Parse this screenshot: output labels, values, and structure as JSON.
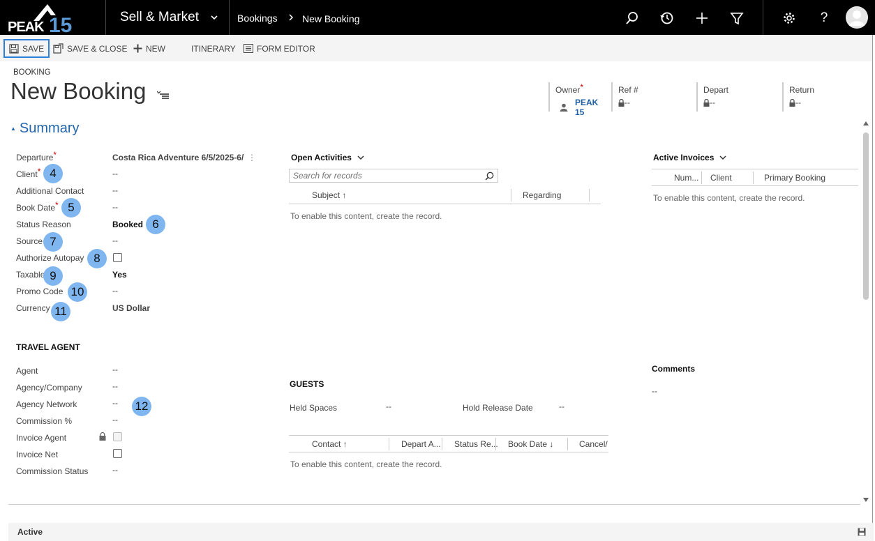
{
  "brand": {
    "logo_text": "PEAK 15"
  },
  "nav": {
    "area": "Sell & Market",
    "breadcrumb_entity": "Bookings",
    "breadcrumb_record": "New Booking"
  },
  "commands": {
    "save": "SAVE",
    "save_close": "SAVE & CLOSE",
    "new": "NEW",
    "itinerary": "ITINERARY",
    "form_editor": "FORM EDITOR"
  },
  "header": {
    "entity": "BOOKING",
    "title": "New Booking",
    "owner_label": "Owner",
    "owner_value": "PEAK 15",
    "ref_label": "Ref #",
    "ref_value": "--",
    "depart_label": "Depart",
    "depart_value": "--",
    "return_label": "Return",
    "return_value": "--"
  },
  "summary": {
    "title": "Summary",
    "fields": {
      "departure_label": "Departure",
      "departure_value": "Costa Rica Adventure 6/5/2025-6/",
      "client_label": "Client",
      "client_value": "--",
      "additional_contact_label": "Additional Contact",
      "additional_contact_value": "--",
      "book_date_label": "Book Date",
      "book_date_value": "--",
      "status_reason_label": "Status Reason",
      "status_reason_value": "Booked",
      "source_label": "Source",
      "source_value": "--",
      "authorize_autopay_label": "Authorize Autopay",
      "taxable_label": "Taxable",
      "taxable_value": "Yes",
      "promo_code_label": "Promo Code",
      "promo_code_value": "--",
      "currency_label": "Currency",
      "currency_value": "US Dollar"
    },
    "badges": [
      "4",
      "5",
      "6",
      "7",
      "8",
      "9",
      "10",
      "11",
      "12"
    ]
  },
  "travel_agent": {
    "title": "TRAVEL AGENT",
    "agent_label": "Agent",
    "agent_value": "--",
    "agency_label": "Agency/Company",
    "agency_value": "--",
    "network_label": "Agency Network",
    "network_value": "--",
    "commission_label": "Commission %",
    "commission_value": "--",
    "invoice_agent_label": "Invoice Agent",
    "invoice_net_label": "Invoice Net",
    "commission_status_label": "Commission Status",
    "commission_status_value": "--"
  },
  "open_activities": {
    "title": "Open Activities",
    "search_placeholder": "Search for records",
    "columns": [
      "Subject ↑",
      "Regarding"
    ],
    "empty": "To enable this content, create the record."
  },
  "active_invoices": {
    "title": "Active Invoices",
    "columns": [
      "Num...",
      "Client",
      "Primary Booking"
    ],
    "empty": "To enable this content, create the record."
  },
  "comments": {
    "title": "Comments",
    "value": "--"
  },
  "guests": {
    "title": "GUESTS",
    "held_spaces_label": "Held Spaces",
    "held_spaces_value": "--",
    "hold_release_label": "Hold Release Date",
    "hold_release_value": "--",
    "columns": [
      "Contact ↑",
      "Depart A...",
      "Status Re...",
      "Book Date ↓",
      "Cancel/"
    ],
    "empty": "To enable this content, create the record."
  },
  "footer": {
    "status": "Active"
  },
  "colors": {
    "accent": "#1e5fa8",
    "badge": "#7fb6f0",
    "topbar": "#000000"
  }
}
